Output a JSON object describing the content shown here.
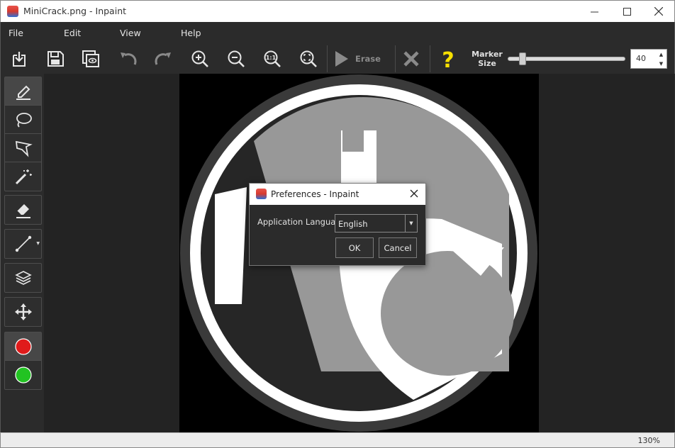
{
  "window": {
    "title": "MiniCrack.png - Inpaint"
  },
  "menu": [
    "File",
    "Edit",
    "View",
    "Help"
  ],
  "toolbar": {
    "erase_label": "Erase",
    "marker_label_line1": "Marker",
    "marker_label_line2": "Size",
    "marker_size_value": "40",
    "marker_size_fraction": 0.1,
    "icons": [
      "open-icon",
      "save-icon",
      "preview-icon",
      "undo-icon",
      "redo-icon",
      "zoom-in-icon",
      "zoom-out-icon",
      "zoom-actual-icon",
      "zoom-fit-icon",
      "erase-play-icon",
      "cancel-x-icon",
      "help-question-icon"
    ]
  },
  "tools": [
    "marker-tool",
    "lasso-tool",
    "polygonal-lasso-tool",
    "magic-wand-tool",
    "eraser-tool",
    "line-tool",
    "layers-tool",
    "move-tool",
    "red-color",
    "green-color"
  ],
  "colors": {
    "red": "#e01b1b",
    "green": "#22c322",
    "accent_help": "#f7e000"
  },
  "status": {
    "zoom": "130%"
  },
  "dialog": {
    "title": "Preferences - Inpaint",
    "language_label": "Application Language",
    "language_value": "English",
    "ok_label": "OK",
    "cancel_label": "Cancel"
  }
}
